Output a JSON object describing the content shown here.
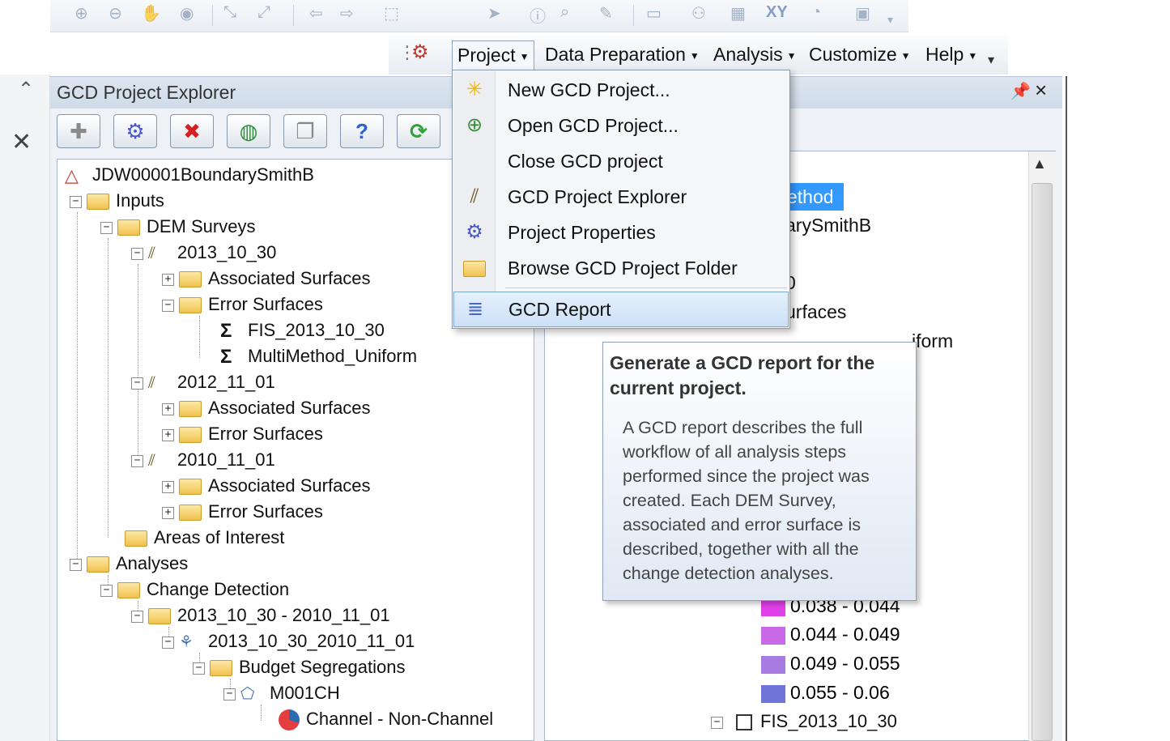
{
  "menubar": {
    "items": [
      "Project",
      "Data Preparation",
      "Analysis",
      "Customize",
      "Help"
    ]
  },
  "toolbar": {
    "xy_label": "XY"
  },
  "explorer": {
    "title": "GCD Project Explorer",
    "buttons": [
      "add-icon",
      "properties-gear-icon",
      "delete-icon",
      "add-layer-icon",
      "copy-icon",
      "help-icon",
      "refresh-icon"
    ]
  },
  "tree": {
    "root": "JDW00001BoundarySmithB",
    "inputs": "Inputs",
    "dem_surveys": "DEM Surveys",
    "survey1": "2013_10_30",
    "assoc": "Associated Surfaces",
    "error": "Error Surfaces",
    "fis": "FIS_2013_10_30",
    "multi": "MultiMethod_Uniform",
    "survey2": "2012_11_01",
    "survey3": "2010_11_01",
    "aoi": "Areas of Interest",
    "analyses": "Analyses",
    "change_detection": "Change Detection",
    "pair_folder": "2013_10_30 - 2010_11_01",
    "pair_dod": "2013_10_30_2010_11_01",
    "budget": "Budget Segregations",
    "mask": "M001CH",
    "class": "Channel - Non-Channel"
  },
  "props": {
    "highlight": "ethod",
    "line1": "arySmithB",
    "line2": "0",
    "line3": "urfaces",
    "line4": "iform",
    "legend": [
      {
        "label": "0.038 - 0.044",
        "color": "#e040e8"
      },
      {
        "label": "0.044 - 0.049",
        "color": "#c86ae8"
      },
      {
        "label": "0.049 - 0.055",
        "color": "#a67be2"
      },
      {
        "label": "0.055 - 0.06",
        "color": "#6f74d8"
      }
    ],
    "bottom": "FIS_2013_10_30"
  },
  "dropdown": {
    "items": [
      "New GCD Project...",
      "Open GCD Project...",
      "Close GCD project",
      "GCD Project Explorer",
      "Project Properties",
      "Browse GCD Project Folder"
    ],
    "report": "GCD Report"
  },
  "tooltip": {
    "title": "Generate a GCD report for the current project.",
    "body": "A GCD report describes the full workflow of all analysis steps performed since the project was created. Each DEM Survey, associated and error surface is described, together with all the change detection analyses."
  }
}
